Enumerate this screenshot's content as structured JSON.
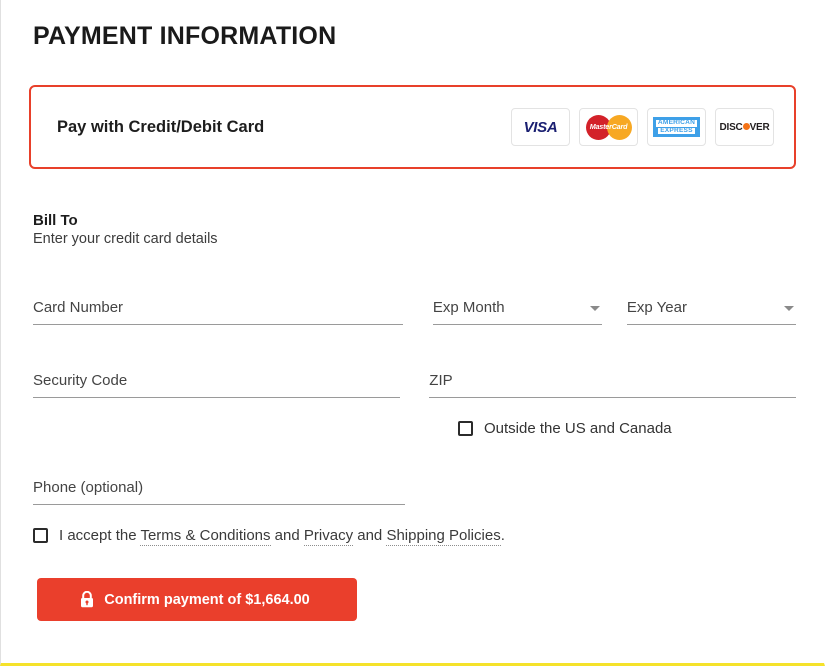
{
  "page": {
    "title": "PAYMENT INFORMATION",
    "accent_red": "#e8402a",
    "button_red": "#ea3f2c",
    "bottom_border_yellow": "#f5e22a"
  },
  "payment_method": {
    "label": "Pay with Credit/Debit Card",
    "selected": true,
    "card_logos": [
      {
        "name": "visa-logo",
        "text": "VISA"
      },
      {
        "name": "mastercard-logo",
        "text": "MasterCard"
      },
      {
        "name": "amex-logo",
        "line1": "AMERICAN",
        "line2": "EXPRESS"
      },
      {
        "name": "discover-logo",
        "text_before": "DISC",
        "text_after": "VER"
      }
    ]
  },
  "bill_to": {
    "heading": "Bill To",
    "subheading": "Enter your credit card details"
  },
  "fields": {
    "card_number": {
      "placeholder": "Card Number",
      "value": ""
    },
    "exp_month": {
      "placeholder": "Exp Month",
      "value": ""
    },
    "exp_year": {
      "placeholder": "Exp Year",
      "value": ""
    },
    "security_code": {
      "placeholder": "Security Code",
      "value": ""
    },
    "zip": {
      "placeholder": "ZIP",
      "value": ""
    },
    "phone": {
      "placeholder": "Phone (optional)",
      "value": ""
    }
  },
  "checkboxes": {
    "outside_us": {
      "label": "Outside the US and Canada",
      "checked": false
    },
    "terms": {
      "checked": false,
      "text_1": "I accept the ",
      "link_1": "Terms & Conditions",
      "text_2": " and ",
      "link_2": "Privacy",
      "text_3": " and ",
      "link_3": "Shipping Policies",
      "text_4": "."
    }
  },
  "confirm_button": {
    "label": "Confirm payment of $1,664.00",
    "amount": "$1,664.00",
    "icon": "lock-icon"
  }
}
